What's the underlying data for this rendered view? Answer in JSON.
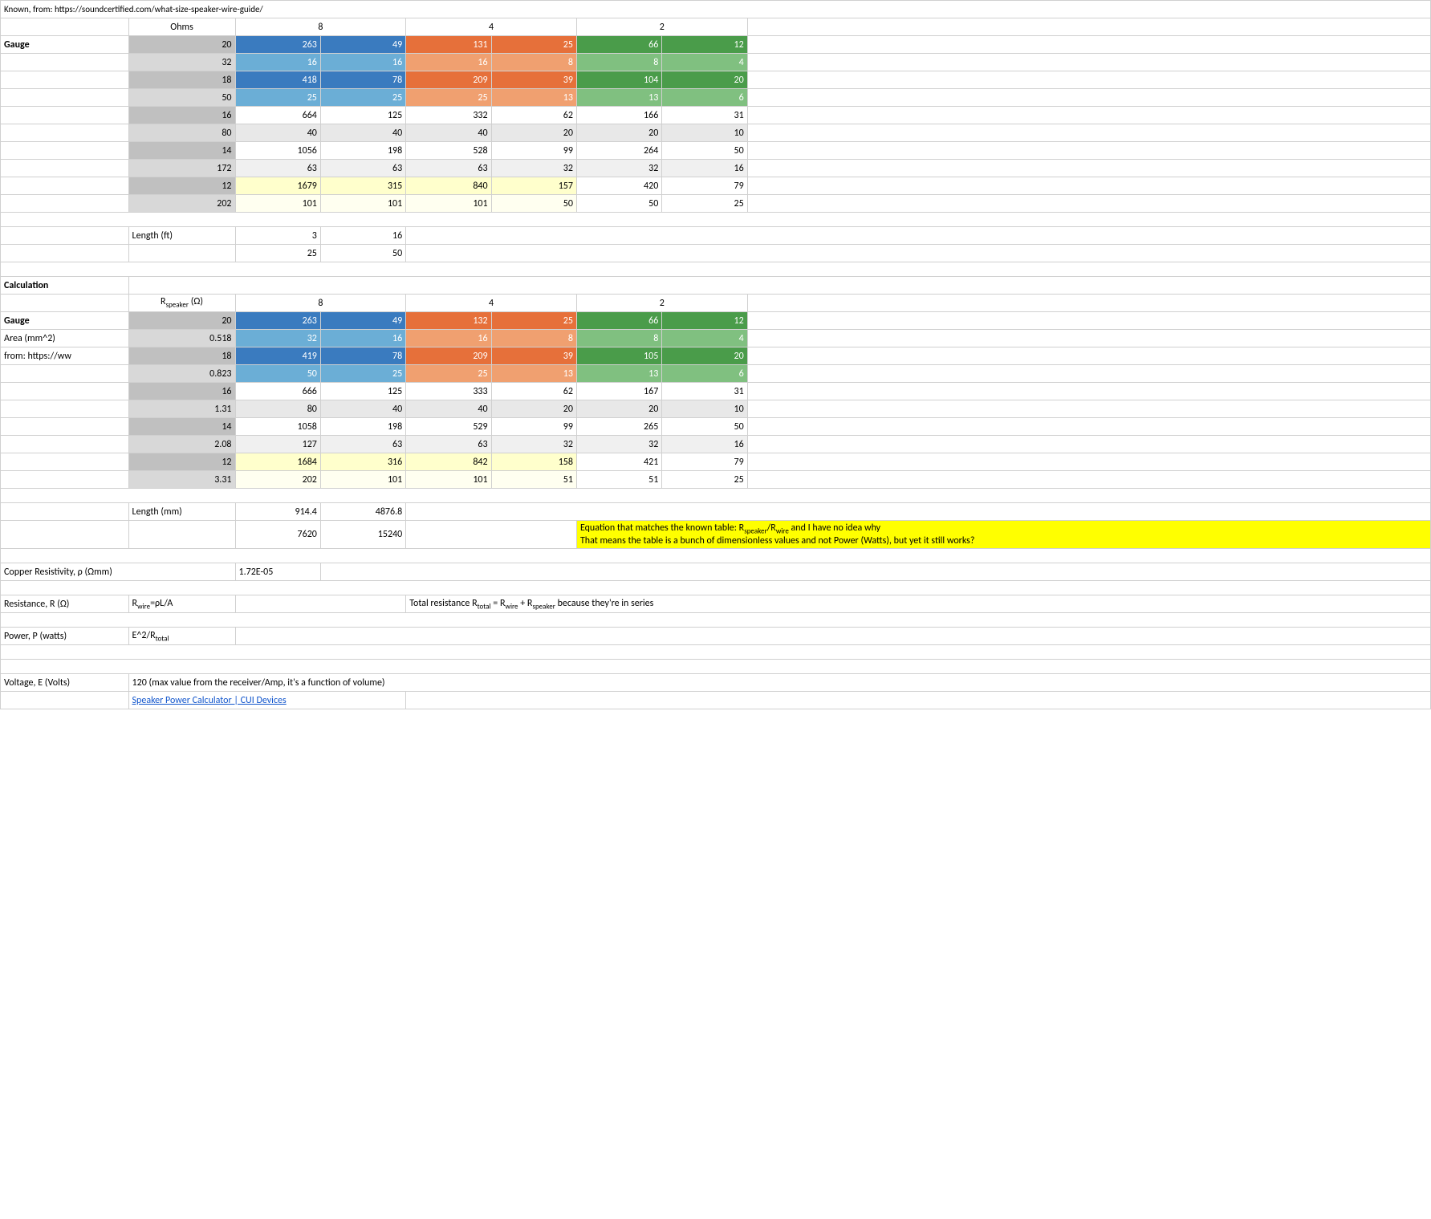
{
  "title": "Speaker Power Calculator CUL Devices",
  "known_from": "Known, from: https://soundcertified.com/what-size-speaker-wire-guide/",
  "sections": {
    "known": {
      "header": "Known, from: https://soundcertified.com/what-size-speaker-wire-guide/",
      "ohms_label": "Ohms",
      "col_8": "8",
      "col_4": "4",
      "col_2": "2",
      "gauge_label": "Gauge",
      "rows": [
        {
          "gauge": "20",
          "sub_gauge": "",
          "v8a": "263",
          "v8b": "49",
          "v4a": "131",
          "v4b": "25",
          "v2a": "66",
          "v2b": "12"
        },
        {
          "gauge": "",
          "sub_gauge": "32",
          "v8a": "16",
          "v8b": "16",
          "v4a": "16",
          "v4b": "8",
          "v2a": "8",
          "v2b": "4"
        },
        {
          "gauge": "18",
          "sub_gauge": "",
          "v8a": "418",
          "v8b": "78",
          "v4a": "209",
          "v4b": "39",
          "v2a": "104",
          "v2b": "20"
        },
        {
          "gauge": "",
          "sub_gauge": "50",
          "v8a": "25",
          "v8b": "25",
          "v4a": "25",
          "v4b": "13",
          "v2a": "13",
          "v2b": "6"
        },
        {
          "gauge": "16",
          "sub_gauge": "",
          "v8a": "664",
          "v8b": "125",
          "v4a": "332",
          "v4b": "62",
          "v2a": "166",
          "v2b": "31"
        },
        {
          "gauge": "",
          "sub_gauge": "80",
          "v8a": "40",
          "v8b": "40",
          "v4a": "40",
          "v4b": "20",
          "v2a": "20",
          "v2b": "10"
        },
        {
          "gauge": "14",
          "sub_gauge": "",
          "v8a": "1056",
          "v8b": "198",
          "v4a": "528",
          "v4b": "99",
          "v2a": "264",
          "v2b": "50"
        },
        {
          "gauge": "",
          "sub_gauge": "172",
          "v8a": "63",
          "v8b": "63",
          "v4a": "63",
          "v4b": "32",
          "v2a": "32",
          "v2b": "16"
        },
        {
          "gauge": "12",
          "sub_gauge": "",
          "v8a": "1679",
          "v8b": "315",
          "v4a": "840",
          "v4b": "157",
          "v2a": "420",
          "v2b": "79"
        },
        {
          "gauge": "",
          "sub_gauge": "202",
          "v8a": "101",
          "v8b": "101",
          "v4a": "101",
          "v4b": "50",
          "v2a": "50",
          "v2b": "25"
        }
      ],
      "length_label": "Length (ft)",
      "length_row1": {
        "col_c": "3",
        "col_d": "16"
      },
      "length_row2": {
        "col_c": "25",
        "col_d": "50"
      }
    },
    "calculation": {
      "label": "Calculation",
      "rspeaker_label": "R",
      "rspeaker_sub": "speaker",
      "rspeaker_unit": " (Ω)",
      "col_8": "8",
      "col_4": "4",
      "col_2": "2",
      "gauge_label": "Gauge",
      "rows": [
        {
          "gauge": "20",
          "area": "0.518",
          "v8a": "263",
          "v8b": "49",
          "v4a": "132",
          "v4b": "25",
          "v2a": "66",
          "v2b": "12"
        },
        {
          "gauge": "32",
          "area": "",
          "v8a": "16",
          "v8b": "16",
          "v4a": "16",
          "v4b": "8",
          "v2a": "8",
          "v2b": "4"
        },
        {
          "gauge": "18",
          "area": "0.823",
          "v8a": "419",
          "v8b": "78",
          "v4a": "209",
          "v4b": "39",
          "v2a": "105",
          "v2b": "20"
        },
        {
          "gauge": "50",
          "area": "",
          "v8a": "25",
          "v8b": "25",
          "v4a": "25",
          "v4b": "13",
          "v2a": "13",
          "v2b": "6"
        },
        {
          "gauge": "16",
          "area": "1.31",
          "v8a": "666",
          "v8b": "125",
          "v4a": "333",
          "v4b": "62",
          "v2a": "167",
          "v2b": "31"
        },
        {
          "gauge": "80",
          "area": "",
          "v8a": "40",
          "v8b": "40",
          "v4a": "40",
          "v4b": "20",
          "v2a": "20",
          "v2b": "10"
        },
        {
          "gauge": "14",
          "area": "2.08",
          "v8a": "1058",
          "v8b": "198",
          "v4a": "529",
          "v4b": "99",
          "v2a": "265",
          "v2b": "50"
        },
        {
          "gauge": "127",
          "area": "",
          "v8a": "63",
          "v8b": "63",
          "v4a": "63",
          "v4b": "32",
          "v2a": "32",
          "v2b": "16"
        },
        {
          "gauge": "12",
          "area": "3.31",
          "v8a": "1684",
          "v8b": "316",
          "v4a": "842",
          "v4b": "158",
          "v2a": "421",
          "v2b": "79"
        },
        {
          "gauge": "202",
          "area": "",
          "v8a": "101",
          "v8b": "101",
          "v4a": "101",
          "v4b": "51",
          "v2a": "51",
          "v2b": "25"
        }
      ],
      "length_label": "Length (mm)",
      "length_row1": {
        "col_c": "914.4",
        "col_d": "4876.8"
      },
      "length_row2": {
        "col_c": "7620",
        "col_d": "15240"
      },
      "equation_text": "Equation that matches the known table: R",
      "equation_sub1": "speaker",
      "equation_text2": "/R",
      "equation_sub2": "wire",
      "equation_text3": " and I have no idea why",
      "equation_line2": "That means the table is a bunch of dimensionless values and not Power (Watts), but yet it still works?",
      "copper_label": "Copper Resistivity, ρ (Ωmm)",
      "copper_value": "1.72E-05",
      "from_label": "from: https://ww",
      "resistance_label": "Resistance, R (Ω)",
      "rwire_formula": "R",
      "rwire_sub": "wire",
      "rwire_formula2": "=ρL/A",
      "total_r_text": "Total resistance R",
      "total_r_sub": "total",
      "total_r_text2": " = R",
      "total_r_sub2": "wire",
      "total_r_text3": " + R",
      "total_r_sub3": "speaker",
      "total_r_text4": " because they're in series",
      "power_label": "Power, P (watts)",
      "power_formula": "E^2/R",
      "power_formula_sub": "total",
      "voltage_label": "Voltage, E (Volts)",
      "voltage_value": "120 (max value from the receiver/Amp, it's a function of volume)",
      "link_text": "Speaker Power Calculator | CUI Devices",
      "link_url": "#"
    }
  }
}
